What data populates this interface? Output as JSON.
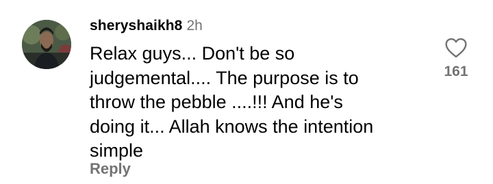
{
  "comment": {
    "username": "sheryshaikh8",
    "time": "2h",
    "text_lines": [
      "Relax guys... Don't be so",
      "judgemental.... The purpose is to",
      "throw the pebble ....!!! And he's",
      "doing it... Allah knows the intention",
      "simple"
    ],
    "reply_label": "Reply",
    "like_count": "161",
    "like_icon": "heart-outline-icon",
    "colors": {
      "text": "#000000",
      "secondary": "#737373",
      "background": "#ffffff"
    }
  }
}
